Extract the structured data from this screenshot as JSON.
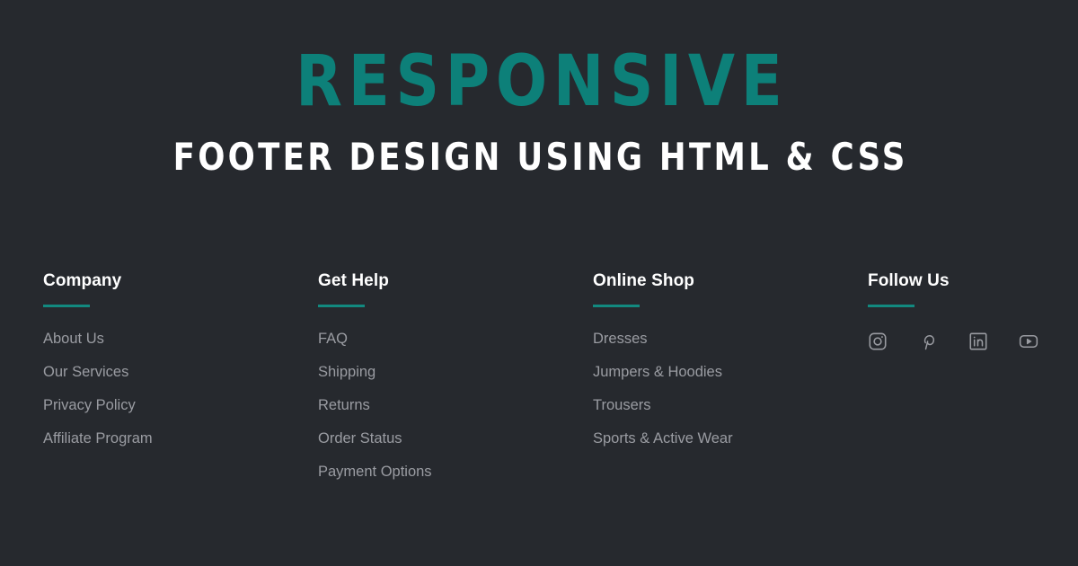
{
  "hero": {
    "title": "RESPONSIVE",
    "subtitle": "FOOTER DESIGN USING HTML & CSS",
    "title_color": "#0d8079",
    "subtitle_color": "#ffffff"
  },
  "theme": {
    "background": "#26292e",
    "accent": "#12897f",
    "heading_color": "#ffffff",
    "link_color": "#9a9ca2"
  },
  "footer": {
    "columns": [
      {
        "heading": "Company",
        "links": [
          "About Us",
          "Our Services",
          "Privacy Policy",
          "Affiliate Program"
        ]
      },
      {
        "heading": "Get Help",
        "links": [
          "FAQ",
          "Shipping",
          "Returns",
          "Order Status",
          "Payment Options"
        ]
      },
      {
        "heading": "Online Shop",
        "links": [
          "Dresses",
          "Jumpers & Hoodies",
          "Trousers",
          "Sports & Active Wear"
        ]
      },
      {
        "heading": "Follow Us",
        "socials": [
          {
            "name": "instagram-icon",
            "label": "Instagram"
          },
          {
            "name": "pinterest-icon",
            "label": "Pinterest"
          },
          {
            "name": "linkedin-icon",
            "label": "LinkedIn"
          },
          {
            "name": "youtube-icon",
            "label": "YouTube"
          }
        ]
      }
    ]
  }
}
